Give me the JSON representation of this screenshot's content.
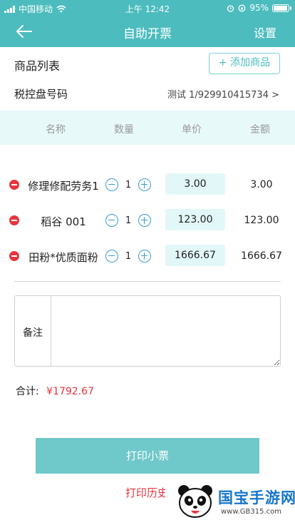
{
  "status_bar": {
    "carrier": "中国移动",
    "time": "上午 12:42",
    "battery": "95%",
    "battery_level": 0.95
  },
  "nav": {
    "back_icon": "arrow-left-icon",
    "title": "自助开票",
    "settings": "设置"
  },
  "product_list": {
    "label": "商品列表",
    "add_button": "+ 添加商品"
  },
  "tax_disk": {
    "label": "税控盘号码",
    "value": "测试 1/929910415734 >"
  },
  "table": {
    "headers": [
      "名称",
      "数量",
      "单价",
      "金额"
    ],
    "rows": [
      {
        "name": "修理修配劳务1",
        "qty": "1",
        "price": "3.00",
        "amount": "3.00"
      },
      {
        "name": "稻谷 001",
        "qty": "1",
        "price": "123.00",
        "amount": "123.00"
      },
      {
        "name": "田粉*优质面粉",
        "qty": "1",
        "price": "1666.67",
        "amount": "1666.67"
      }
    ]
  },
  "remark": {
    "label": "备注",
    "value": ""
  },
  "total": {
    "label": "合计:",
    "value": "¥1792.67"
  },
  "actions": {
    "print": "打印小票",
    "history": "打印历史"
  },
  "watermark": {
    "title": "国宝手游网",
    "url": "www.GB315.com"
  },
  "colors": {
    "brand": "#4cbcbe",
    "danger": "#e5363e",
    "price_bg": "#e2f7f8",
    "header_bg": "#e8f9fa",
    "stepper": "#3a9bd6"
  }
}
